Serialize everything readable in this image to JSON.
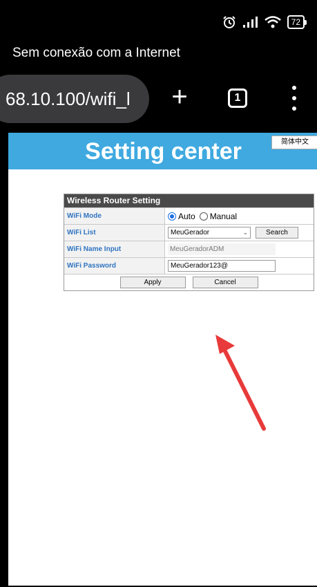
{
  "status_bar": {
    "battery": "72",
    "icons": [
      "alarm-icon",
      "signal-icon",
      "wifi-icon",
      "battery-icon"
    ]
  },
  "offline_message": "Sem conexão com a Internet",
  "browser": {
    "url": "68.10.100/wifi_l",
    "new_tab_glyph": "+",
    "tab_count": "1"
  },
  "page": {
    "title": "Setting center",
    "language_button": "简体中文",
    "table": {
      "header": "Wireless Router Setting",
      "wifi_mode_label": "WiFi Mode",
      "mode_auto": "Auto",
      "mode_manual": "Manual",
      "mode_selected": "Auto",
      "wifi_list_label": "WiFi List",
      "wifi_list_value": "MeuGerador",
      "search_button": "Search",
      "name_input_label": "WiFi Name Input",
      "name_input_value": "MeuGeradorADM",
      "password_label": "WiFi Password",
      "password_value": "MeuGerador123@",
      "apply_button": "Apply",
      "cancel_button": "Cancel"
    }
  },
  "annotation": {
    "arrow_color": "#e83a3a"
  },
  "colors": {
    "header_band": "#3fa9e0",
    "label_text": "#2f74c0",
    "table_header": "#4a4a4a"
  }
}
